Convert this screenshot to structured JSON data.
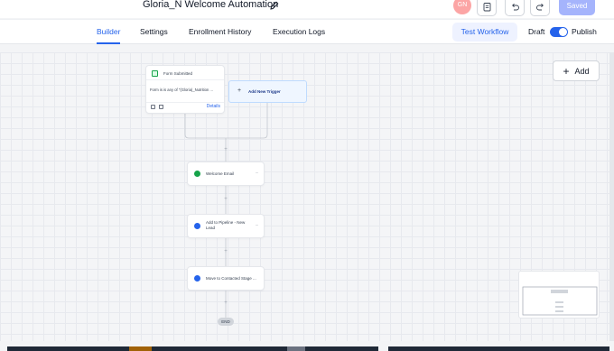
{
  "header": {
    "title": "Gloria_N Welcome Automation",
    "avatar_initials": "GN",
    "saved_label": "Saved"
  },
  "nav": {
    "tabs": [
      {
        "label": "Builder",
        "active": true
      },
      {
        "label": "Settings",
        "active": false
      },
      {
        "label": "Enrollment History",
        "active": false
      },
      {
        "label": "Execution Logs",
        "active": false
      }
    ],
    "test_workflow_label": "Test Workflow",
    "draft_label": "Draft",
    "publish_label": "Publish",
    "publish_toggle_on": true
  },
  "canvas": {
    "add_label": "Add",
    "trigger": {
      "title": "Form Submitted",
      "condition": "Form is is any of \"(Gloria)_Nutrition ...",
      "details_label": "Details"
    },
    "new_trigger_label": "Add New Trigger",
    "actions": [
      {
        "label": "Welcome Email",
        "icon": "email-icon",
        "color": "#16a34a"
      },
      {
        "label": "Add to Pipeline - New Lead",
        "icon": "pipeline-icon",
        "color": "#2563eb"
      },
      {
        "label": "Move to Contacted Stage ...",
        "icon": "pipeline-icon",
        "color": "#2563eb"
      }
    ],
    "end_label": "END"
  },
  "colors": {
    "accent": "#2563eb",
    "saved_button": "#a5b4fc",
    "avatar": "#fca5a5"
  }
}
